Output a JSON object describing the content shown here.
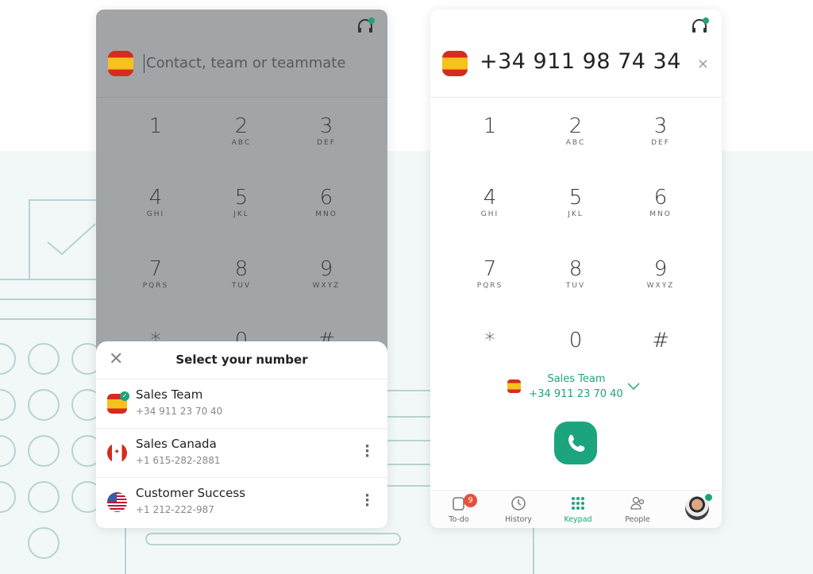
{
  "left_dialer": {
    "search_placeholder": "Contact, team or teammate",
    "keys": [
      {
        "d": "1",
        "l": ""
      },
      {
        "d": "2",
        "l": "ABC"
      },
      {
        "d": "3",
        "l": "DEF"
      },
      {
        "d": "4",
        "l": "GHI"
      },
      {
        "d": "5",
        "l": "JKL"
      },
      {
        "d": "6",
        "l": "MNO"
      },
      {
        "d": "7",
        "l": "PQRS"
      },
      {
        "d": "8",
        "l": "TUV"
      },
      {
        "d": "9",
        "l": "WXYZ"
      },
      {
        "d": "*",
        "l": ""
      },
      {
        "d": "0",
        "l": ""
      },
      {
        "d": "#",
        "l": ""
      }
    ],
    "sheet": {
      "title": "Select your number",
      "items": [
        {
          "name": "Sales Team",
          "number": "+34 911 23 70 40",
          "flag": "spain",
          "selected": true
        },
        {
          "name": "Sales Canada",
          "number": "+1 615-282-2881",
          "flag": "canada"
        },
        {
          "name": "Customer Success",
          "number": "+1 212-222-987",
          "flag": "usa"
        }
      ]
    }
  },
  "right_dialer": {
    "phone_number": "+34 911 98 74 34",
    "clear_icon": "×",
    "keys": [
      {
        "d": "1",
        "l": ""
      },
      {
        "d": "2",
        "l": "ABC"
      },
      {
        "d": "3",
        "l": "DEF"
      },
      {
        "d": "4",
        "l": "GHI"
      },
      {
        "d": "5",
        "l": "JKL"
      },
      {
        "d": "6",
        "l": "MNO"
      },
      {
        "d": "7",
        "l": "PQRS"
      },
      {
        "d": "8",
        "l": "TUV"
      },
      {
        "d": "9",
        "l": "WXYZ"
      },
      {
        "d": "*",
        "l": ""
      },
      {
        "d": "0",
        "l": ""
      },
      {
        "d": "#",
        "l": ""
      }
    ],
    "selected_number": {
      "name": "Sales Team",
      "number": "+34 911 23 70 40"
    },
    "nav": [
      {
        "label": "To-do",
        "badge": "9",
        "icon": "todo-icon"
      },
      {
        "label": "History",
        "icon": "history-icon"
      },
      {
        "label": "Keypad",
        "icon": "keypad-icon",
        "active": true
      },
      {
        "label": "People",
        "icon": "people-icon"
      }
    ]
  },
  "colors": {
    "accent": "#1ca47e",
    "badge": "#e8503a",
    "overlay": "#a2a5a8",
    "decor": "#b6d3d3"
  }
}
